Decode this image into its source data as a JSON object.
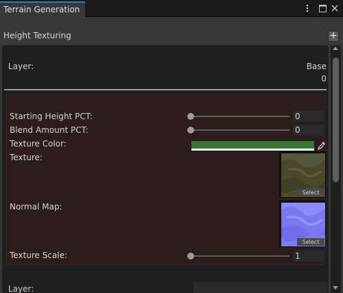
{
  "window": {
    "tab_title": "Terrain Generation",
    "menu_icon": "kebab-menu-icon",
    "maximize_icon": "maximize-icon",
    "close_icon": "close-icon"
  },
  "section": {
    "title": "Height Texturing",
    "add_label": "+"
  },
  "layer": {
    "label": "Layer:",
    "name": "Base",
    "index": "0"
  },
  "fields": {
    "starting_height": {
      "label": "Starting Height PCT:",
      "value": "0",
      "fraction": 0
    },
    "blend_amount": {
      "label": "Blend Amount PCT:",
      "value": "0",
      "fraction": 0
    },
    "texture_color": {
      "label": "Texture Color:",
      "color": "#3b7637"
    },
    "texture": {
      "label": "Texture:",
      "select_label": "Select"
    },
    "normal_map": {
      "label": "Normal Map:",
      "select_label": "Select"
    },
    "texture_scale": {
      "label": "Texture Scale:",
      "value": "1",
      "fraction": 0
    }
  },
  "next_layer": {
    "label": "Layer:"
  }
}
